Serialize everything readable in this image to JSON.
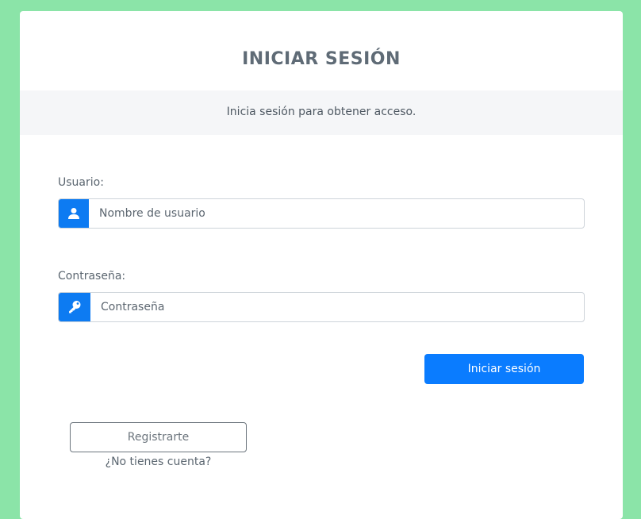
{
  "login": {
    "title": "INICIAR SESIÓN",
    "subtitle": "Inicia sesión para obtener acceso.",
    "username_label": "Usuario:",
    "username_placeholder": "Nombre de usuario",
    "password_label": "Contraseña:",
    "password_placeholder": "Contraseña",
    "submit_label": "Iniciar sesión",
    "register_label": "Registrarte",
    "register_hint": "¿No tienes cuenta?"
  },
  "icons": {
    "username": "user-icon",
    "password": "key-icon"
  },
  "colors": {
    "background": "#8be4a8",
    "primary": "#0a7cff",
    "title": "#5f6b76"
  }
}
